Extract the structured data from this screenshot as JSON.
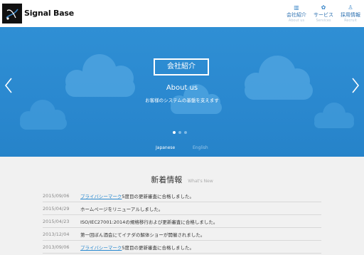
{
  "header": {
    "logo_text": "Signal Base",
    "nav": [
      {
        "label": "会社紹介",
        "sub": "About us",
        "icon": "building-icon"
      },
      {
        "label": "サービス",
        "sub": "Services",
        "icon": "gear-icon"
      },
      {
        "label": "採用情報",
        "sub": "Recruit",
        "icon": "person-icon"
      }
    ]
  },
  "hero": {
    "button_label": "会社紹介",
    "title": "About us",
    "subtitle": "お客様のシステムの基盤を支えます",
    "languages": [
      "Japanese",
      "English"
    ],
    "active_language": "Japanese",
    "slides": 3,
    "active_slide": 1,
    "colors": {
      "background": "#2a88cf",
      "cloud": "#4da3e0"
    }
  },
  "news": {
    "title": "新着情報",
    "subtitle": "What's New",
    "items": [
      {
        "date": "2015/09/06",
        "link": "プライバシーマーク",
        "text": "5度目の更新審査に合格しました。"
      },
      {
        "date": "2015/04/29",
        "link": "",
        "text": "ホームページをリニューアルしました。"
      },
      {
        "date": "2015/04/23",
        "link": "",
        "text": "ISO/IEC27001:2014の規格移行および更新審査に合格しました。"
      },
      {
        "date": "2013/12/04",
        "link": "",
        "text": "第一回ぼん酒会にてイナダの解体ショーが開催されました。"
      },
      {
        "date": "2013/09/06",
        "link": "プライバシーマーク",
        "text": "5度目の更新審査に合格しました。"
      }
    ]
  }
}
